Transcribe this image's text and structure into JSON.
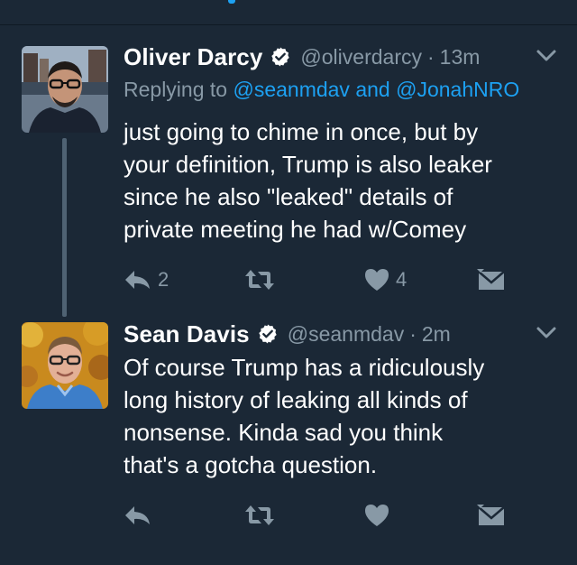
{
  "colors": {
    "background": "#1b2836",
    "text": "#ffffff",
    "muted": "#8899a6",
    "link": "#1da1f2",
    "thread_line": "#4f6273"
  },
  "tweets": [
    {
      "display_name": "Oliver Darcy",
      "handle": "@oliverdarcy",
      "separator": "·",
      "time": "13m",
      "replying_prefix": "Replying to ",
      "replying_user_1": "@seanmdav",
      "replying_conjunction": " and ",
      "replying_user_2": "@JonahNRO",
      "text": "just going to chime in once, but by\nyour definition, Trump is also leaker\nsince he also \"leaked\" details of\nprivate meeting he had w/Comey",
      "reply_count": "2",
      "retweet_count": "",
      "like_count": "4",
      "icons": {
        "avatar": "avatar-photo",
        "verified": "verified-badge-icon",
        "menu": "chevron-down-icon",
        "reply": "reply-icon",
        "retweet": "retweet-icon",
        "like": "heart-icon",
        "dm": "envelope-icon"
      }
    },
    {
      "display_name": "Sean Davis",
      "handle": "@seanmdav",
      "separator": "·",
      "time": "2m",
      "text": "Of course Trump has a ridiculously\nlong history of leaking all kinds of\nnonsense. Kinda sad you think\nthat's a gotcha question.",
      "reply_count": "",
      "retweet_count": "",
      "like_count": "",
      "icons": {
        "avatar": "avatar-photo",
        "verified": "verified-badge-icon",
        "menu": "chevron-down-icon",
        "reply": "reply-icon",
        "retweet": "retweet-icon",
        "like": "heart-icon",
        "dm": "envelope-icon"
      }
    }
  ]
}
